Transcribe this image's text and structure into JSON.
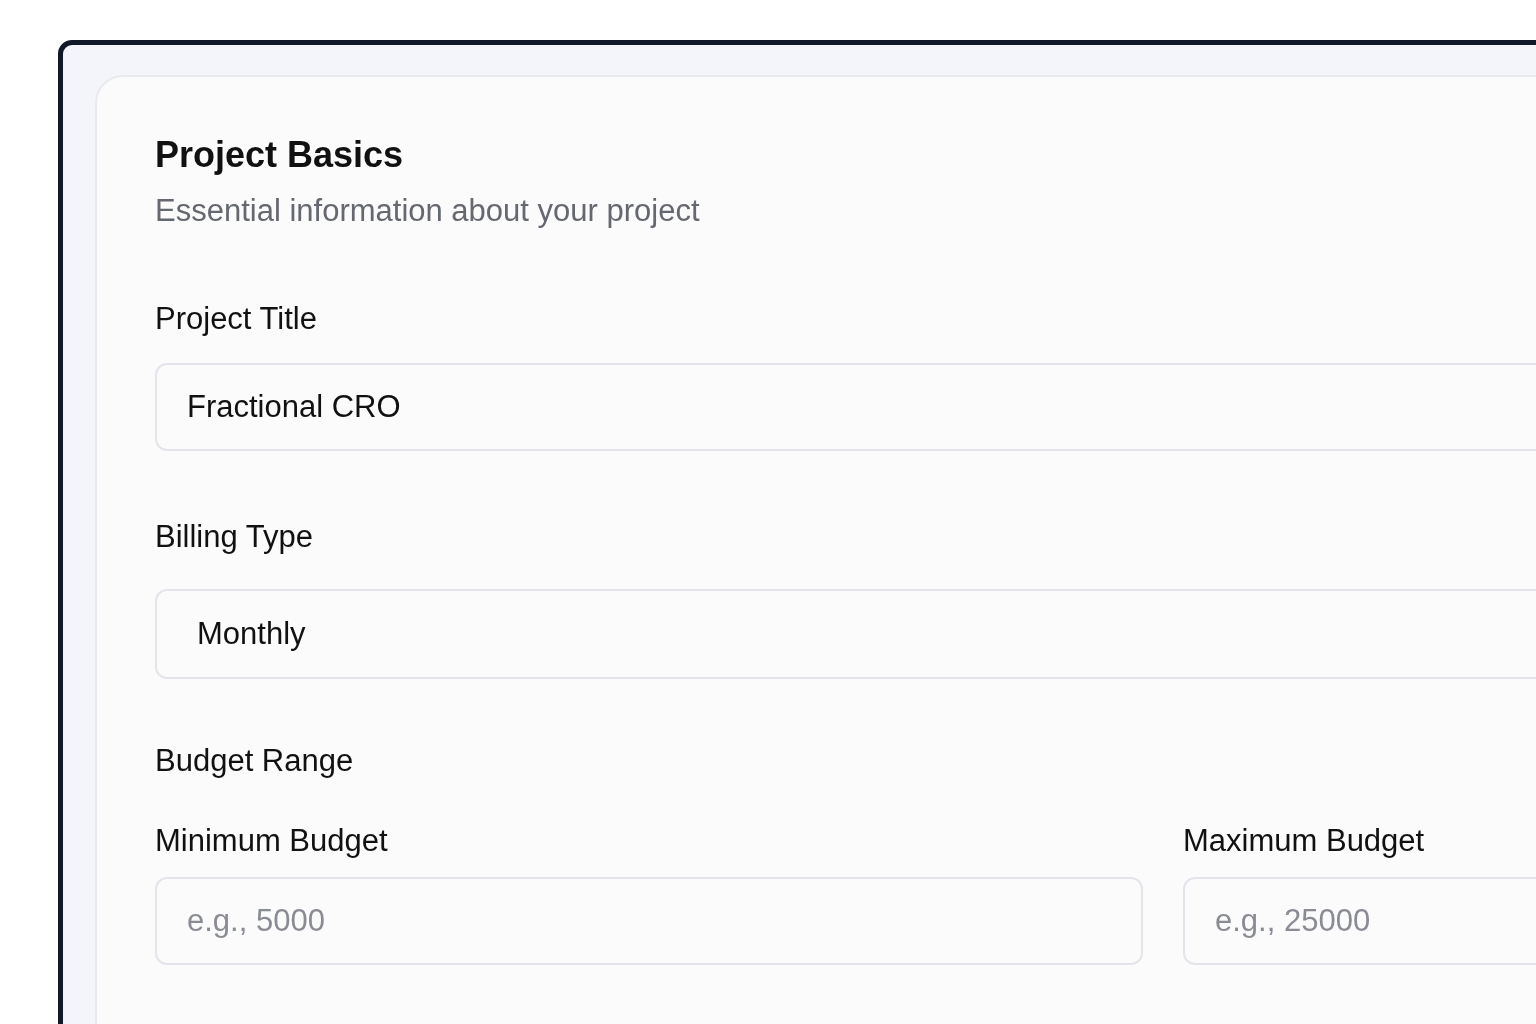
{
  "section": {
    "title": "Project Basics",
    "subtitle": "Essential information about your project"
  },
  "fields": [
    {
      "kind": "text",
      "label": "Project Title",
      "value": "Fractional CRO"
    },
    {
      "kind": "select",
      "label": "Billing Type",
      "value": "Monthly"
    }
  ],
  "budget": {
    "label": "Budget Range",
    "fields": [
      {
        "label": "Minimum Budget",
        "placeholder": "e.g., 5000"
      },
      {
        "label": "Maximum Budget",
        "placeholder": "e.g., 25000"
      }
    ]
  }
}
